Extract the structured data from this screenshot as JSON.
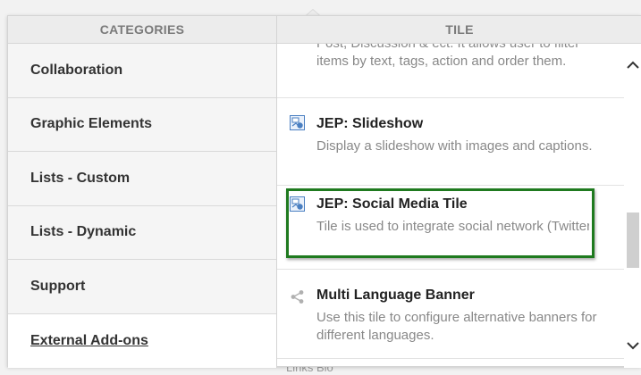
{
  "categories": {
    "header": "CATEGORIES",
    "items": [
      {
        "label": "Collaboration"
      },
      {
        "label": "Graphic Elements"
      },
      {
        "label": "Lists - Custom"
      },
      {
        "label": "Lists - Dynamic"
      },
      {
        "label": "Support"
      },
      {
        "label": "External Add-ons",
        "active": true
      }
    ]
  },
  "tiles": {
    "header": "TILE",
    "items": [
      {
        "title": "",
        "description": "Tile shows recent contents: Document, Blog Post, Discussion & ect. It allows user to filter items by text, tags, action and order them.",
        "description_visible": "Post, Discussion & ect. It allows user to filter items by text, tags, action and order them.",
        "icon": "jive-tile-icon"
      },
      {
        "title": "JEP: Slideshow",
        "description": "Display a slideshow with images and captions.",
        "icon": "jive-tile-icon"
      },
      {
        "title": "JEP: Social Media Tile",
        "description": "Tile is used to integrate social network (Twitter, Facebook, Instagram) feed in jive",
        "icon": "jive-tile-icon",
        "highlighted": true
      },
      {
        "title": "Multi Language Banner",
        "description": "Use this tile to configure alternative banners for different languages.",
        "icon": "share-icon"
      }
    ]
  },
  "background": {
    "bottom_text": "Links Blo"
  },
  "colors": {
    "highlight_border": "#1f7a1f",
    "tile_icon": "#4a7fc1",
    "share_icon": "#b0b0b0"
  }
}
